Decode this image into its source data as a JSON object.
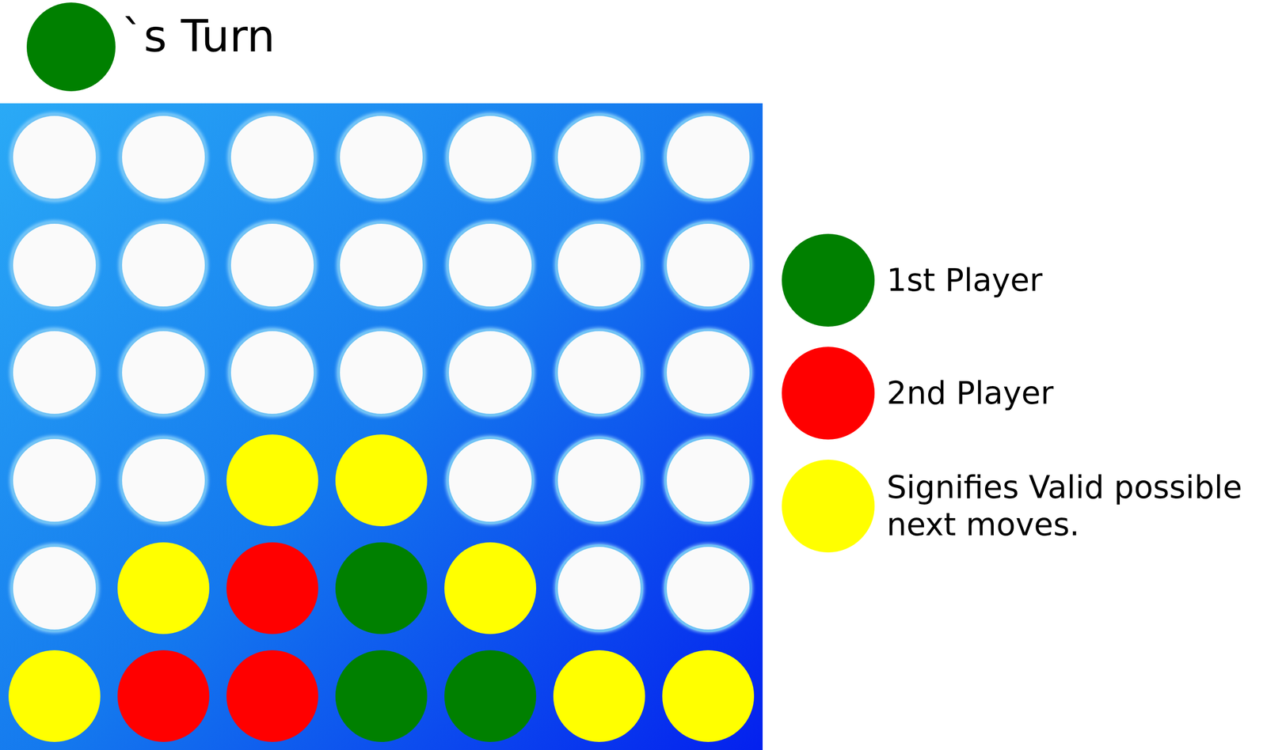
{
  "turn": {
    "color": "#008000",
    "label": "`s Turn"
  },
  "board": {
    "rows": [
      [
        {
          "kind": "empty"
        },
        {
          "kind": "empty"
        },
        {
          "kind": "empty"
        },
        {
          "kind": "empty"
        },
        {
          "kind": "empty"
        },
        {
          "kind": "empty"
        },
        {
          "kind": "empty"
        }
      ],
      [
        {
          "kind": "empty"
        },
        {
          "kind": "empty"
        },
        {
          "kind": "empty"
        },
        {
          "kind": "empty"
        },
        {
          "kind": "empty"
        },
        {
          "kind": "empty"
        },
        {
          "kind": "empty"
        }
      ],
      [
        {
          "kind": "empty"
        },
        {
          "kind": "empty"
        },
        {
          "kind": "empty"
        },
        {
          "kind": "empty"
        },
        {
          "kind": "empty"
        },
        {
          "kind": "empty"
        },
        {
          "kind": "empty"
        }
      ],
      [
        {
          "kind": "empty"
        },
        {
          "kind": "empty"
        },
        {
          "kind": "valid",
          "color": "#ffff00"
        },
        {
          "kind": "valid",
          "color": "#ffff00"
        },
        {
          "kind": "empty"
        },
        {
          "kind": "empty"
        },
        {
          "kind": "empty"
        }
      ],
      [
        {
          "kind": "empty"
        },
        {
          "kind": "valid",
          "color": "#ffff00"
        },
        {
          "kind": "piece",
          "color": "#ff0000"
        },
        {
          "kind": "piece",
          "color": "#008000"
        },
        {
          "kind": "valid",
          "color": "#ffff00"
        },
        {
          "kind": "empty"
        },
        {
          "kind": "empty"
        }
      ],
      [
        {
          "kind": "valid",
          "color": "#ffff00"
        },
        {
          "kind": "piece",
          "color": "#ff0000"
        },
        {
          "kind": "piece",
          "color": "#ff0000"
        },
        {
          "kind": "piece",
          "color": "#008000"
        },
        {
          "kind": "piece",
          "color": "#008000"
        },
        {
          "kind": "valid",
          "color": "#ffff00"
        },
        {
          "kind": "valid",
          "color": "#ffff00"
        }
      ]
    ]
  },
  "legend": [
    {
      "label": "1st Player",
      "color": "#008000"
    },
    {
      "label": "2nd Player",
      "color": "#ff0000"
    },
    {
      "label": "Signifies Valid possible next moves.",
      "color": "#ffff00"
    }
  ]
}
